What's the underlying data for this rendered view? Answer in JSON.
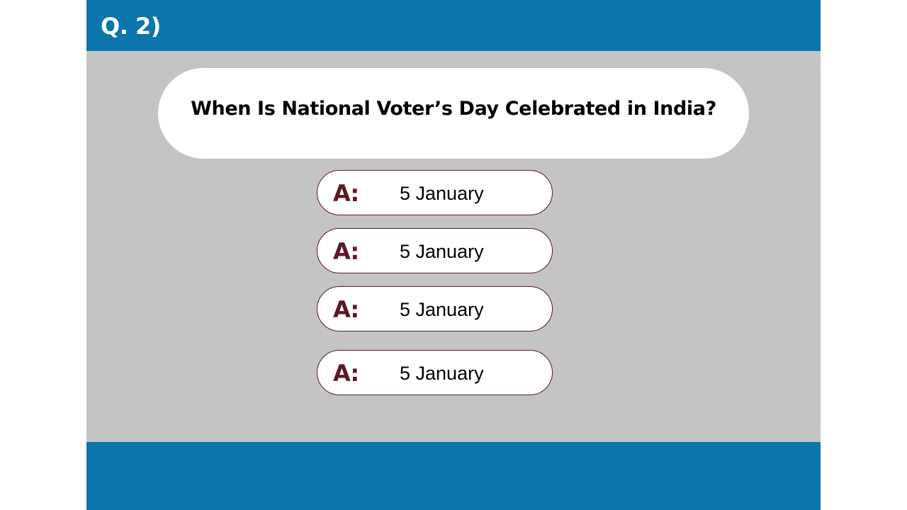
{
  "header": {
    "question_number": "Q. 2)"
  },
  "question": {
    "text": "When Is National Voter’s Day Celebrated in India?"
  },
  "answers": [
    {
      "prefix": "A:",
      "text": "5 January"
    },
    {
      "prefix": "A:",
      "text": "5 January"
    },
    {
      "prefix": "A:",
      "text": "5 January"
    },
    {
      "prefix": "A:",
      "text": "5 January"
    }
  ],
  "colors": {
    "header": "#0b76ab",
    "footer": "#0b76ab",
    "background": "#c4c4c4",
    "accent": "#5a1a24"
  }
}
